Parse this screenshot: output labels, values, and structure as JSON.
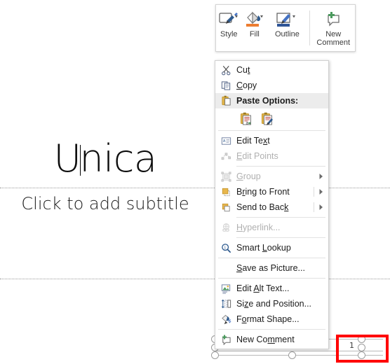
{
  "slide": {
    "title": "Unica",
    "subtitle_placeholder": "Click to add subtitle",
    "slide_number": "1"
  },
  "mini_toolbar": {
    "buttons": [
      {
        "label": "Style",
        "icon": "shape-style-icon",
        "has_dropdown": true
      },
      {
        "label": "Fill",
        "icon": "fill-bucket-icon",
        "has_dropdown": true
      },
      {
        "label": "Outline",
        "icon": "shape-outline-pencil-icon",
        "has_dropdown": true
      },
      {
        "label_line1": "New",
        "label_line2": "Comment",
        "icon": "new-comment-icon",
        "has_dropdown": false
      }
    ]
  },
  "context_menu": {
    "items": [
      {
        "id": "cut",
        "label": "Cut",
        "icon": "scissors-icon",
        "disabled": false,
        "submenu": false,
        "underline": "t"
      },
      {
        "id": "copy",
        "label": "Copy",
        "icon": "copy-pages-icon",
        "disabled": false,
        "submenu": false,
        "underline": "C"
      },
      {
        "id": "paste-options",
        "label": "Paste Options:",
        "icon": "clipboard-icon",
        "disabled": false,
        "submenu": false,
        "header": true,
        "highlight": true
      },
      {
        "id": "paste-keep-text",
        "label": "",
        "icon": "paste-keep-text-only-icon"
      },
      {
        "id": "paste-keep-format",
        "label": "",
        "icon": "paste-keep-source-formatting-icon"
      },
      {
        "id": "edit-text",
        "label": "Edit Text",
        "icon": "edit-text-icon",
        "disabled": false,
        "submenu": false,
        "underline": "x"
      },
      {
        "id": "edit-points",
        "label": "Edit Points",
        "icon": "edit-points-icon",
        "disabled": true,
        "submenu": false,
        "underline": "E"
      },
      {
        "id": "group",
        "label": "Group",
        "icon": "group-shapes-icon",
        "disabled": true,
        "submenu": true,
        "underline": "G"
      },
      {
        "id": "bring-to-front",
        "label": "Bring to Front",
        "icon": "bring-to-front-icon",
        "disabled": false,
        "submenu": true,
        "underline": "r"
      },
      {
        "id": "send-to-back",
        "label": "Send to Back",
        "icon": "send-to-back-icon",
        "disabled": false,
        "submenu": true,
        "underline": "k"
      },
      {
        "id": "hyperlink",
        "label": "Hyperlink...",
        "icon": "hyperlink-icon",
        "disabled": true,
        "submenu": false,
        "underline": "H"
      },
      {
        "id": "smart-lookup",
        "label": "Smart Lookup",
        "icon": "smart-lookup-icon",
        "disabled": false,
        "submenu": false,
        "underline": "L"
      },
      {
        "id": "save-as-picture",
        "label": "Save as Picture...",
        "icon": "",
        "disabled": false,
        "submenu": false,
        "underline": "S"
      },
      {
        "id": "edit-alt-text",
        "label": "Edit Alt Text...",
        "icon": "edit-alt-text-icon",
        "disabled": false,
        "submenu": false,
        "underline": "A"
      },
      {
        "id": "size-and-position",
        "label": "Size and Position...",
        "icon": "size-position-icon",
        "disabled": false,
        "submenu": false,
        "underline": "z"
      },
      {
        "id": "format-shape",
        "label": "Format Shape...",
        "icon": "format-shape-icon",
        "disabled": false,
        "submenu": false,
        "underline": "o"
      },
      {
        "id": "new-comment",
        "label": "New Comment",
        "icon": "new-comment-icon",
        "disabled": false,
        "submenu": false,
        "underline": "m"
      }
    ],
    "labels": {
      "cut": "Cut",
      "copy": "Copy",
      "paste_options": "Paste Options:",
      "edit_text": "Edit Text",
      "edit_points": "Edit Points",
      "group": "Group",
      "bring_to_front": "Bring to Front",
      "send_to_back": "Send to Back",
      "hyperlink": "Hyperlink...",
      "smart_lookup": "Smart Lookup",
      "save_as_picture": "Save as Picture...",
      "edit_alt_text": "Edit Alt Text...",
      "size_and_position": "Size and Position...",
      "format_shape": "Format Shape...",
      "new_comment": "New Comment"
    }
  },
  "colors": {
    "accent_orange": "#ED7D31",
    "accent_blue": "#4472C4",
    "accent_green": "#4C9A5E",
    "menu_highlight": "#ECECEC",
    "annotation_red": "#FF0000",
    "handle_gray": "#9B9B9B"
  }
}
